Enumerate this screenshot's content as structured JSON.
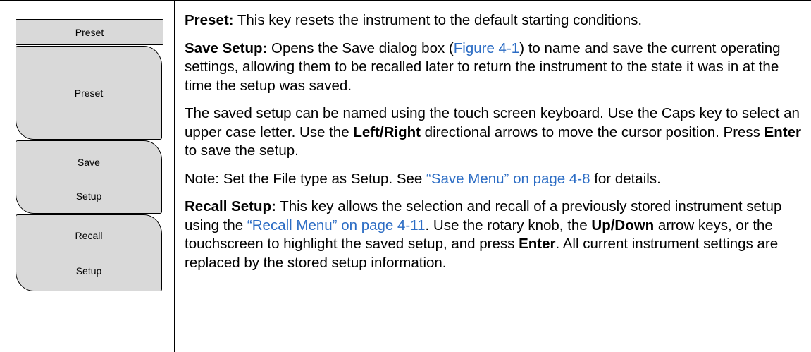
{
  "menu": {
    "title": "Preset",
    "keys": [
      {
        "line1": "Preset"
      },
      {
        "line1": "Save",
        "line2": "Setup"
      },
      {
        "line1": "Recall",
        "line2": "Setup"
      }
    ]
  },
  "content": {
    "p1": {
      "term": "Preset:",
      "text": " This key resets the instrument to the default starting conditions."
    },
    "p2": {
      "term": "Save Setup:",
      "text_a": " Opens the Save dialog box (",
      "link": "Figure 4-1",
      "text_b": ") to name and save the current operating settings, allowing them to be recalled later to return the instrument to the state it was in at the time the setup was saved."
    },
    "p3": {
      "text_a": "The saved setup can be named using the touch screen keyboard. Use the Caps key to select an upper case letter. Use the ",
      "bold_a": "Left/Right",
      "text_b": " directional arrows to move the cursor position. Press ",
      "bold_b": "Enter",
      "text_c": " to save the setup."
    },
    "p4": {
      "text_a": "Note: Set the File type as Setup. See ",
      "link": "“Save Menu” on page 4-8",
      "text_b": " for details."
    },
    "p5": {
      "term": "Recall Setup:",
      "text_a": " This key allows the selection and recall of a previously stored instrument setup using the ",
      "link": "“Recall Menu” on page 4-11",
      "text_b": ". Use the rotary knob, the ",
      "bold_a": "Up/Down",
      "text_c": " arrow keys, or the touchscreen to highlight the saved setup, and press ",
      "bold_b": "Enter",
      "text_d": ". All current instrument settings are replaced by the stored setup information."
    }
  },
  "colors": {
    "link": "#2b6cc4",
    "key_fill": "#d9d9d9"
  }
}
